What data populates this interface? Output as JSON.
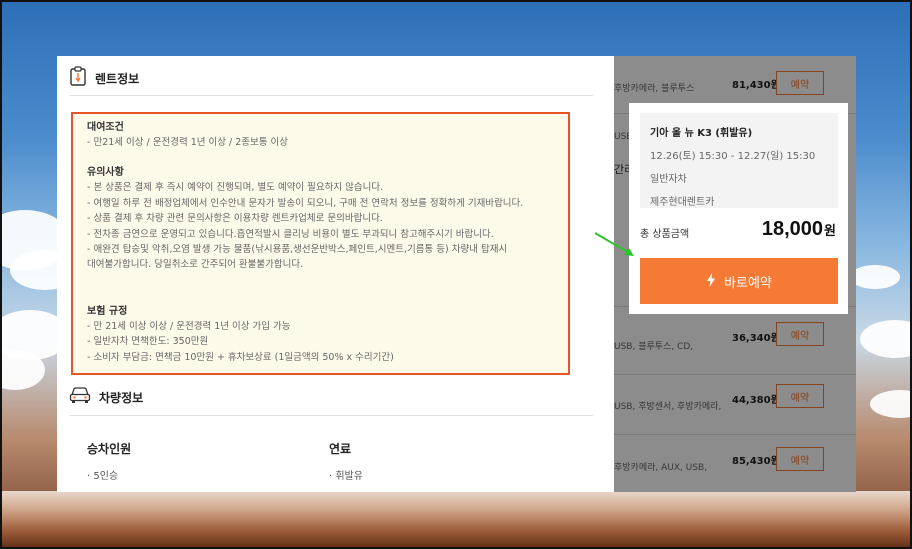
{
  "rental_info": {
    "section_title": "렌트정보",
    "conditions": {
      "heading": "대여조건",
      "lines": [
        "- 만21세 이상 / 운전경력 1년 이상 / 2종보통 이상"
      ]
    },
    "notes": {
      "heading": "유의사항",
      "lines": [
        "- 본 상품은 결제 후 즉시 예약이 진행되며, 별도 예약이 필요하지 않습니다.",
        "- 여행일 하루 전 배정업체에서 인수안내 문자가 발송이 되오니, 구매 전 연락처 정보를 정확하게 기재바랍니다.",
        "- 상품 결제 후 차량 관련 문의사항은 이용차량 렌트카업체로 문의바랍니다.",
        "- 전차종 금연으로 운영되고 있습니다.흡연적발시 클리닝 비용이 별도 부과되니 참고해주시기 바랍니다.",
        "- 애완견 탑승및 악취,오염 발생 가능 물품(낚시용품,생선운반박스,페인트,시멘트,기름통 등) 차량내 탑재시",
        "대여불가합니다. 당일취소로 간주되어 환불불가합니다."
      ]
    },
    "insurance": {
      "heading": "보험 규정",
      "lines": [
        "- 만 21세 이상 이상 / 운전경력 1년 이상 가입 가능",
        "- 일반자차 면책한도: 350만원",
        "- 소비자 부담금: 면책금 10만원 + 휴차보상료 (1일금액의 50% x 수리기간)"
      ]
    }
  },
  "vehicle_info": {
    "section_title": "차량정보",
    "capacity_label": "승차인원",
    "capacity_value": "· 5인승",
    "fuel_label": "연료",
    "fuel_value": "· 휘발유"
  },
  "summary": {
    "car_name": "기아 올 뉴 K3 (휘발유)",
    "period": "12.26(토) 15:30 - 12.27(일) 15:30",
    "insurance_type": "일반자차",
    "company": "제주현대렌트카",
    "total_label": "총 상품금액",
    "total_amount": "18,000",
    "currency": "원",
    "book_button": "바로예약"
  },
  "background_list": {
    "partial_text": "간리",
    "rows": [
      {
        "features": "후방카메라, 블루투스",
        "price": "81,430원",
        "button": "예약"
      },
      {
        "features": "USB, 블루투스",
        "price": "",
        "button": ""
      },
      {
        "features": "",
        "price": "",
        "button": ""
      },
      {
        "features": "USB, 블루투스, CD,",
        "price": "36,340원",
        "button": "예약"
      },
      {
        "features": "USB, 후방센서, 후방카메라,",
        "price": "44,380원",
        "button": "예약"
      },
      {
        "features": "후방카메라, AUX, USB,",
        "price": "85,430원",
        "button": "예약"
      }
    ]
  },
  "colors": {
    "accent": "#f47a35",
    "highlight_border": "#e8542a",
    "terms_background": "#fcfbea",
    "arrow": "#2ec22e"
  }
}
